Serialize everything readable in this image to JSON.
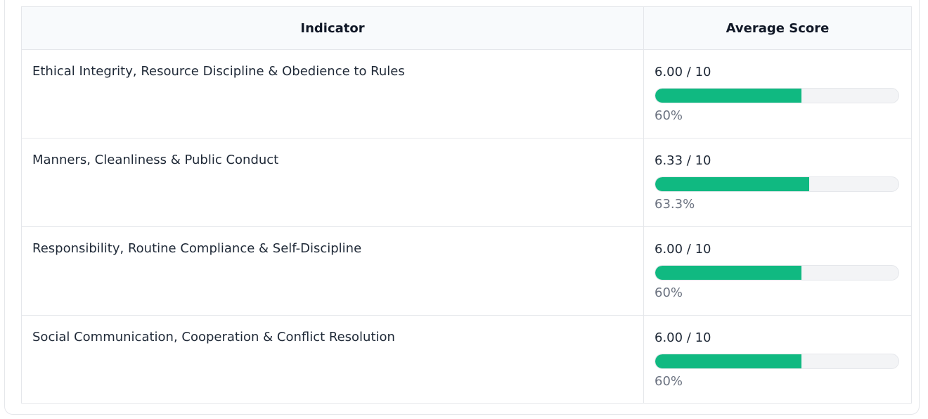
{
  "table": {
    "headers": {
      "indicator": "Indicator",
      "average_score": "Average Score"
    },
    "rows": [
      {
        "indicator": "Ethical Integrity, Resource Discipline & Obedience to Rules",
        "score": "6.00 / 10",
        "percent_label": "60%",
        "percent": 60
      },
      {
        "indicator": "Manners, Cleanliness & Public Conduct",
        "score": "6.33 / 10",
        "percent_label": "63.3%",
        "percent": 63.3
      },
      {
        "indicator": "Responsibility, Routine Compliance & Self-Discipline",
        "score": "6.00 / 10",
        "percent_label": "60%",
        "percent": 60
      },
      {
        "indicator": "Social Communication, Cooperation & Conflict Resolution",
        "score": "6.00 / 10",
        "percent_label": "60%",
        "percent": 60
      }
    ]
  },
  "colors": {
    "bar_fill": "#10b981",
    "bar_track": "#f3f4f6",
    "header_bg": "#f8fafc",
    "border": "#e5e7eb",
    "muted_text": "#6b7280"
  }
}
